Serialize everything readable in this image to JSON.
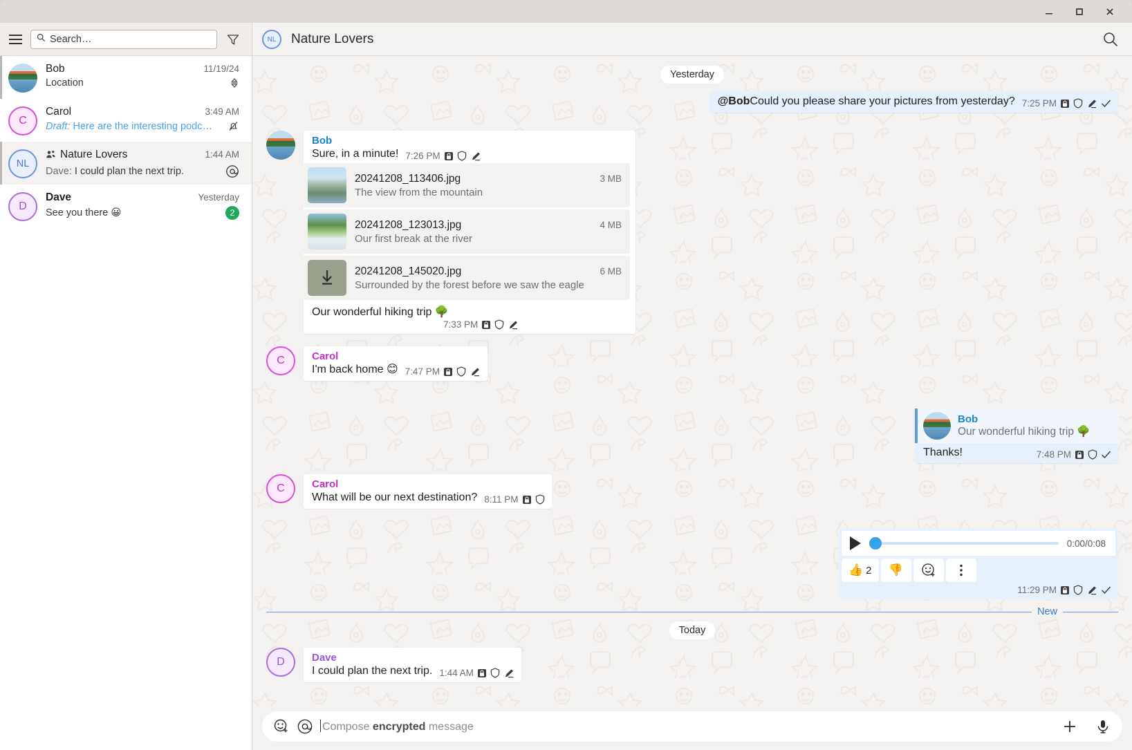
{
  "window": {
    "controls": {
      "minimize": "minimize-button",
      "maximize": "maximize-button",
      "close": "close-button"
    }
  },
  "sidebar": {
    "search": {
      "placeholder": "Search…",
      "value": ""
    },
    "menu_label": "hamburger-menu",
    "filter_label": "filter",
    "chats": [
      {
        "name": "Bob",
        "time": "11/19/24",
        "preview": "Location",
        "avatar_type": "photo",
        "avatar_text": "",
        "right_glyph": "sort-arrows",
        "selected": false,
        "bold": false
      },
      {
        "name": "Carol",
        "time": "3:49 AM",
        "draft_label": "Draft:",
        "preview": "Here are the interesting podc…",
        "avatar_type": "initial",
        "avatar_text": "C",
        "right_glyph": "muted-bell",
        "selected": false,
        "bold": false
      },
      {
        "name": "Nature Lovers",
        "time": "1:44 AM",
        "preview_sender": "Dave:",
        "preview": "I could plan the next trip.",
        "avatar_type": "initial",
        "avatar_text": "NL",
        "right_glyph": "mention-at",
        "selected": true,
        "is_group": true,
        "bold": false
      },
      {
        "name": "Dave",
        "time": "Yesterday",
        "preview": "See you there 😀",
        "avatar_type": "initial",
        "avatar_text": "D",
        "right_glyph": "unread-count",
        "unread_count": "2",
        "selected": false,
        "bold": true
      }
    ]
  },
  "chat": {
    "title": "Nature Lovers",
    "avatar_text": "NL",
    "search_label": "search-in-chat",
    "day_dividers": {
      "yesterday": "Yesterday",
      "today": "Today"
    },
    "new_divider": "New",
    "messages": [
      {
        "id": "m1",
        "direction": "out",
        "mention": "@Bob",
        "text": " Could you please share your pictures from yesterday?",
        "time": "7:25 PM",
        "icons": [
          "lock-icon",
          "shield-icon",
          "pencil-icon",
          "check-icon"
        ]
      },
      {
        "id": "m2",
        "direction": "in",
        "sender": "Bob",
        "sender_color": "#1a86c8",
        "text": "Sure, in a minute!",
        "time": "7:26 PM",
        "icons": [
          "lock-icon",
          "shield-icon",
          "pencil-icon"
        ],
        "attachments": [
          {
            "filename": "20241208_113406.jpg",
            "size": "3 MB",
            "caption": "The view from the mountain",
            "thumb": "photo-mountain"
          },
          {
            "filename": "20241208_123013.jpg",
            "size": "4 MB",
            "caption": "Our first break at the river",
            "thumb": "photo-river"
          },
          {
            "filename": "20241208_145020.jpg",
            "size": "6 MB",
            "caption": "Surrounded by the forest before we saw the eagle",
            "thumb": "download-pending"
          }
        ],
        "attachment_caption": "Our wonderful hiking trip 🌳",
        "attachment_time": "7:33 PM",
        "attachment_icons": [
          "lock-icon",
          "shield-icon",
          "pencil-icon"
        ]
      },
      {
        "id": "m3",
        "direction": "in",
        "sender": "Carol",
        "sender_color": "#c52fc5",
        "text": "I'm back home 😊",
        "time": "7:47 PM",
        "icons": [
          "lock-icon",
          "shield-icon",
          "pencil-icon"
        ]
      },
      {
        "id": "m4",
        "direction": "out",
        "quote": {
          "sender": "Bob",
          "text": "Our wonderful hiking trip 🌳"
        },
        "text": "Thanks!",
        "time": "7:48 PM",
        "icons": [
          "lock-icon",
          "shield-icon",
          "check-icon"
        ]
      },
      {
        "id": "m5",
        "direction": "in",
        "sender": "Carol",
        "sender_color": "#c52fc5",
        "text": "What will be our next destination?",
        "time": "8:11 PM",
        "icons": [
          "lock-icon",
          "shield-icon"
        ]
      },
      {
        "id": "m6",
        "direction": "out",
        "type": "voice",
        "duration": "0:00/0:08",
        "progress_percent": 2,
        "reactions": [
          {
            "emoji": "👍",
            "count": "2"
          },
          {
            "emoji": "👎",
            "count": ""
          }
        ],
        "add_reaction_label": "add-reaction",
        "more_label": "more-options",
        "time": "11:29 PM",
        "icons": [
          "lock-icon",
          "shield-icon",
          "pencil-icon",
          "check-icon"
        ]
      },
      {
        "id": "m7",
        "direction": "in",
        "sender": "Dave",
        "sender_color": "#9a55cf",
        "text": "I could plan the next trip.",
        "time": "1:44 AM",
        "icons": [
          "lock-icon",
          "shield-icon",
          "pencil-icon"
        ]
      }
    ]
  },
  "compose": {
    "placeholder_prefix": "Compose ",
    "placeholder_bold": "encrypted",
    "placeholder_suffix": " message",
    "value": "",
    "emoji_label": "add-emoji",
    "mention_label": "mention",
    "attach_label": "attach",
    "mic_label": "voice-record"
  },
  "colors": {
    "accent_blue": "#1a86c8",
    "out_bubble": "#e6f0fb",
    "unread_green": "#1fa855",
    "carol": "#c52fc5",
    "dave": "#9a55cf"
  }
}
